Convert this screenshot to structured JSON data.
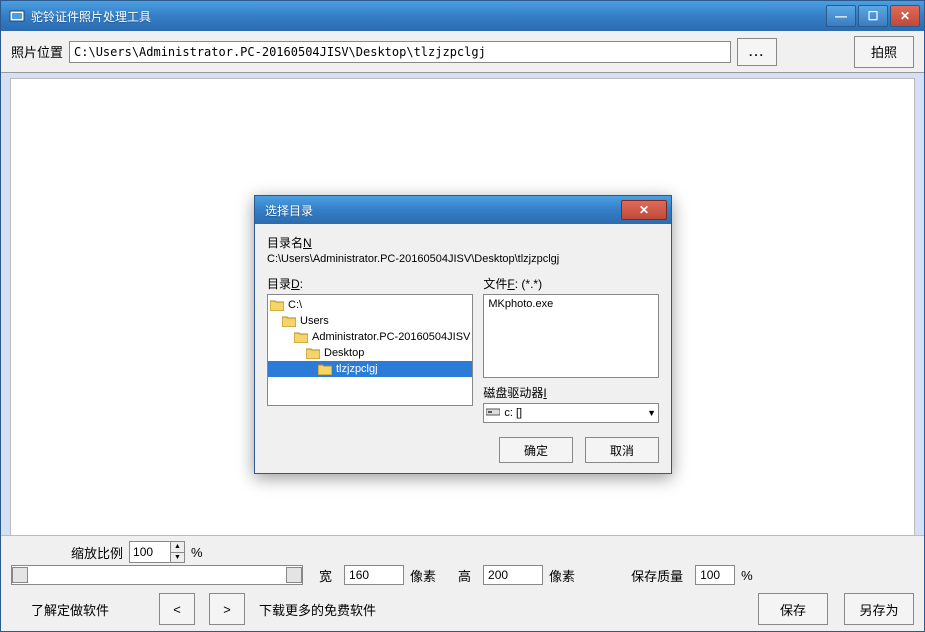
{
  "window": {
    "title": "驼铃证件照片处理工具"
  },
  "toolbar": {
    "path_label": "照片位置",
    "path_value": "C:\\Users\\Administrator.PC-20160504JISV\\Desktop\\tlzjzpclgj",
    "browse_label": "...",
    "capture_label": "拍照"
  },
  "bottom": {
    "zoom_label": "缩放比例",
    "zoom_value": "100",
    "zoom_suffix": "%",
    "width_label": "宽",
    "width_value": "160",
    "width_unit": "像素",
    "height_label": "高",
    "height_value": "200",
    "height_unit": "像素",
    "quality_label": "保存质量",
    "quality_value": "100",
    "quality_suffix": "%",
    "learn_link": "了解定做软件",
    "prev_label": "<",
    "next_label": ">",
    "download_link": "下载更多的免费软件",
    "save_label": "保存",
    "saveas_label": "另存为"
  },
  "dialog": {
    "title": "选择目录",
    "dirname_label_pre": "目录名",
    "dirname_label_acc": "N",
    "dirname_value": "C:\\Users\\Administrator.PC-20160504JISV\\Desktop\\tlzjzpclgj",
    "dirlist_label_pre": "目录",
    "dirlist_label_acc": "D",
    "dirlist_label_suf": ":",
    "filelist_label_pre": "文件",
    "filelist_label_acc": "F",
    "filelist_label_suf": ": (*.*)",
    "dir_items": [
      {
        "label": "C:\\",
        "indent": 0,
        "selected": false
      },
      {
        "label": "Users",
        "indent": 1,
        "selected": false
      },
      {
        "label": "Administrator.PC-20160504JISV",
        "indent": 2,
        "selected": false
      },
      {
        "label": "Desktop",
        "indent": 3,
        "selected": false
      },
      {
        "label": "tlzjzpclgj",
        "indent": 4,
        "selected": true
      }
    ],
    "file_items": [
      "MKphoto.exe"
    ],
    "drive_label_pre": "磁盘驱动器",
    "drive_label_acc": "I",
    "drive_value": "c: []",
    "ok_label": "确定",
    "cancel_label": "取消"
  }
}
